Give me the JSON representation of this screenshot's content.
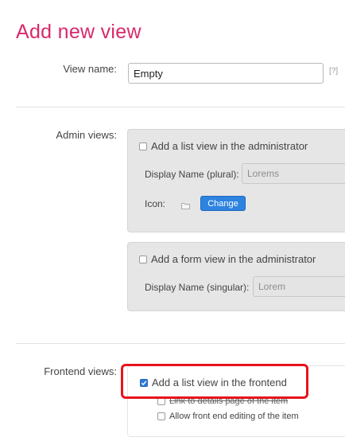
{
  "page": {
    "title": "Add new view"
  },
  "view_name": {
    "label": "View name:",
    "value": "Empty",
    "help": "[?]"
  },
  "admin_views": {
    "label": "Admin views:",
    "list_view": {
      "checkbox_label": "Add a list view in the administrator",
      "checked": false,
      "display_name_label": "Display Name (plural):",
      "display_name_value": "Lorems",
      "icon_label": "Icon:",
      "icon_name": "folder-icon",
      "change_label": "Change"
    },
    "form_view": {
      "checkbox_label": "Add a form view in the administrator",
      "checked": false,
      "display_name_label": "Display Name (singular):",
      "display_name_value": "Lorem"
    }
  },
  "frontend_views": {
    "label": "Frontend views:",
    "list_view": {
      "checkbox_label": "Add a list view in the frontend",
      "checked": true
    },
    "link_details": {
      "checkbox_label": "Link to details page of the item",
      "checked": false
    },
    "allow_editing": {
      "checkbox_label": "Allow front end editing of the item",
      "checked": false
    }
  },
  "colors": {
    "title": "#d9286b",
    "highlight": "#e8141b",
    "button": "#2d83e0"
  }
}
